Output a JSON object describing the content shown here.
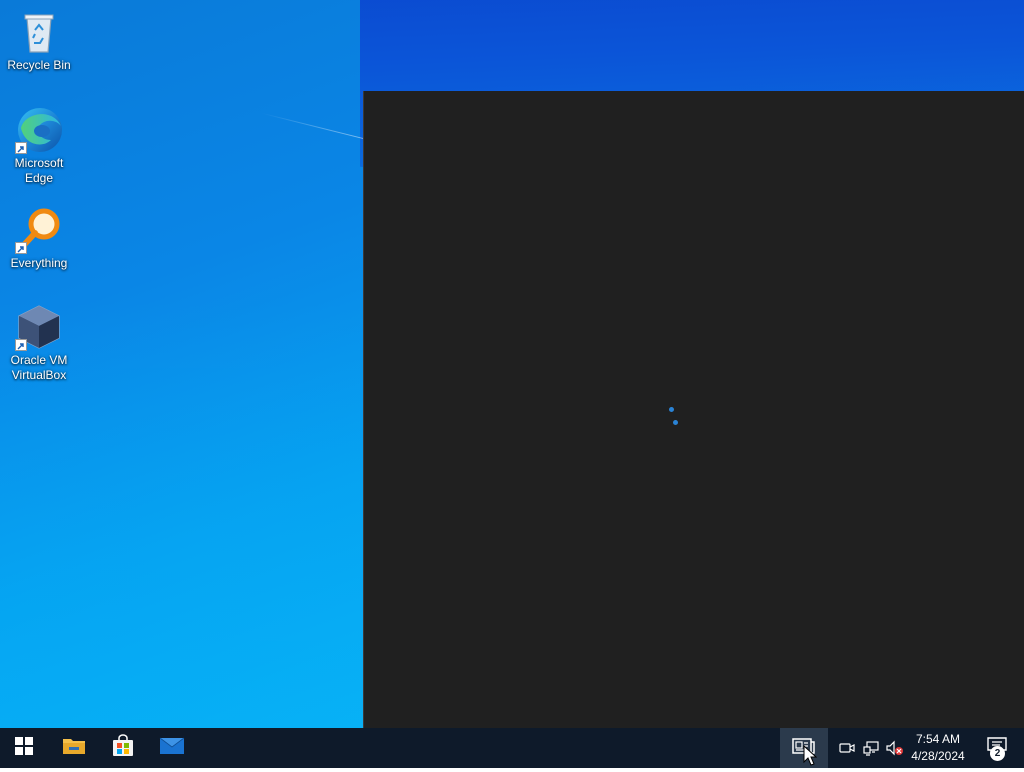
{
  "desktop": {
    "icons": [
      {
        "label": "Recycle Bin",
        "icon": "recycle-bin-icon"
      },
      {
        "label": "Microsoft\nEdge",
        "icon": "edge-icon"
      },
      {
        "label": "Everything",
        "icon": "everything-icon"
      },
      {
        "label": "Oracle VM\nVirtualBox",
        "icon": "virtualbox-icon"
      }
    ]
  },
  "panel": {
    "state": "loading"
  },
  "taskbar": {
    "pinned": [
      {
        "name": "Start",
        "icon": "windows-logo-icon"
      },
      {
        "name": "File Explorer",
        "icon": "folder-icon"
      },
      {
        "name": "Microsoft Store",
        "icon": "store-icon"
      },
      {
        "name": "Mail",
        "icon": "mail-icon"
      }
    ],
    "news_button": {
      "icon": "news-and-interests-icon"
    },
    "tray": {
      "icons": [
        "meet-now-icon",
        "network-icon",
        "volume-muted-icon"
      ],
      "time": "7:54 AM",
      "date": "4/28/2024",
      "notification_count": "2"
    }
  },
  "colors": {
    "accent": "#2a83d6",
    "panel_bg": "#202020",
    "taskbar_bg": "#0e1a2a"
  }
}
